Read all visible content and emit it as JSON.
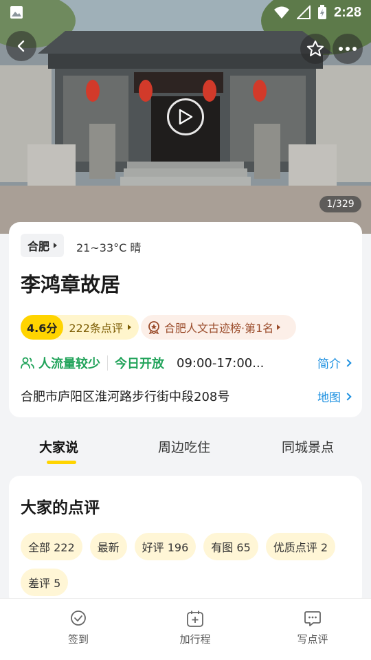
{
  "status_bar": {
    "time": "2:28"
  },
  "hero": {
    "photo_count": "1/329"
  },
  "header": {
    "back_icon": "back-arrow-icon",
    "favorite_icon": "star-outline-icon",
    "more_icon": "more-dots-icon"
  },
  "info": {
    "city": "合肥",
    "weather": "21~33°C 晴",
    "title": "李鸿章故居",
    "score": "4.6分",
    "review_count": "222条点评",
    "rank": "合肥人文古迹榜·第1名",
    "crowd": "人流量较少",
    "open_today": "今日开放",
    "hours": "09:00-17:00...",
    "intro_link": "简介",
    "address": "合肥市庐阳区淮河路步行街中段208号",
    "map_link": "地图",
    "accent_color": "#21a35a",
    "link_color": "#1a8fe0"
  },
  "tabs": [
    {
      "label": "大家说"
    },
    {
      "label": "周边吃住"
    },
    {
      "label": "同城景点"
    }
  ],
  "reviews": {
    "title": "大家的点评",
    "filters": [
      {
        "label": "全部 222"
      },
      {
        "label": "最新"
      },
      {
        "label": "好评 196"
      },
      {
        "label": "有图 65"
      },
      {
        "label": "优质点评 2"
      },
      {
        "label": "差评 5"
      }
    ]
  },
  "bottom_bar": [
    {
      "label": "签到",
      "icon": "check-circle-icon"
    },
    {
      "label": "加行程",
      "icon": "calendar-add-icon"
    },
    {
      "label": "写点评",
      "icon": "comment-icon"
    }
  ],
  "brand_color": "#ffd400"
}
